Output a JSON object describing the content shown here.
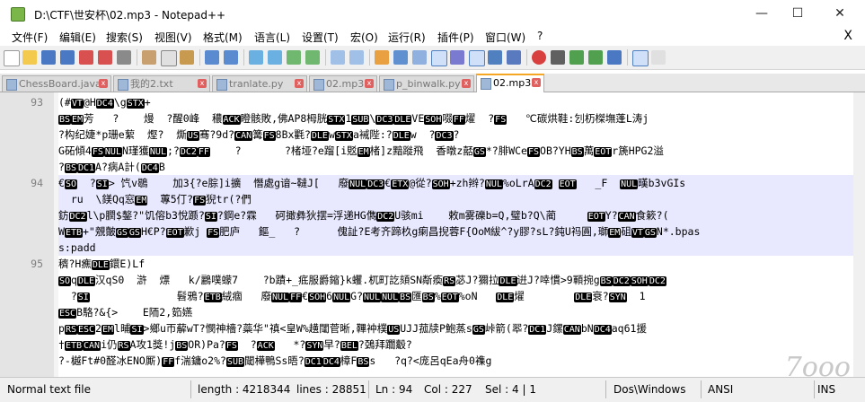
{
  "window": {
    "title": "D:\\CTF\\世安杯\\02.mp3 - Notepad++",
    "min_glyph": "—",
    "max_glyph": "☐",
    "close_glyph": "✕"
  },
  "menu": [
    "文件(F)",
    "编辑(E)",
    "搜索(S)",
    "视图(V)",
    "格式(M)",
    "语言(L)",
    "设置(T)",
    "宏(O)",
    "运行(R)",
    "插件(P)",
    "窗口(W)",
    "?"
  ],
  "menu_close": "X",
  "toolbar": {
    "icons": [
      "new-file-icon",
      "open-file-icon",
      "save-icon",
      "save-all-icon",
      "close-icon",
      "close-all-icon",
      "print-icon",
      "cut-icon",
      "copy-icon",
      "paste-icon",
      "undo-icon",
      "redo-icon",
      "find-icon",
      "replace-icon",
      "zoom-in-icon",
      "zoom-out-icon",
      "sync-v-icon",
      "sync-h-icon",
      "word-wrap-icon",
      "show-all-icon",
      "indent-guide-icon",
      "lang-icon",
      "doc-map-icon",
      "func-list-icon",
      "folder-icon",
      "monitor-icon",
      "record-icon",
      "stop-icon",
      "play-icon",
      "play-multi-icon",
      "save-macro-icon",
      "spellcheck-icon",
      "spellcheck-opt-icon"
    ]
  },
  "tabs": [
    {
      "label": "ChessBoard.java",
      "active": false
    },
    {
      "label": "我的2.txt",
      "active": false
    },
    {
      "label": "tranlate.py",
      "active": false
    },
    {
      "label": "02.mp3",
      "active": false
    },
    {
      "label": "p_binwalk.py",
      "active": false
    },
    {
      "label": "02.mp3",
      "active": true
    }
  ],
  "editor": {
    "lines": [
      {
        "num": "93",
        "text": "(#VT@HDC4\\gSTX+",
        "hl": false
      },
      {
        "num": "",
        "text": "BSEM芳   ?    熳  ?醒0峰  穠ACK瞪骸敗,佛AP8栂胱STX1SUB\\DC3DLEVESOH啜FF燿  ?FS   ℃碳烘鞋:刉杤榤墲蓬L涛j",
        "hl": false
      },
      {
        "num": "",
        "text": "?构纪婕*p珊e蕠  熞?  燍US骞?9d?CAN篝FS8Bx氍?DLEwSTXa裓陛:?DLEw  ?DC3?",
        "hl": false
      },
      {
        "num": "",
        "text": "G砳傾4FSNULN瑾獲NUL;?DC2FF    ?       ?楮垭?e蹓[i覐EM楮]z黯蹝飛  香暾z嚭GS*?腓WCeFSOB?YHBS萬EOTr篪HPG2溢",
        "hl": false
      },
      {
        "num": "",
        "text": "?BSDC1A?病A計(DC4B",
        "hl": false
      },
      {
        "num": "94",
        "text": "€SO  ?SI> 饩v鶡    加3{?e腙]i擴  憯處g谙~韃J[   廢NULDC3€ETX@從?SOH+zh辫?NUL%oLrADC2 EOT   _F  NUL暵b3vGIs",
        "hl": true
      },
      {
        "num": "",
        "text": "  ru  \\鎂Qq窓EM  蓴5仃?FS猊tr(?們",
        "hl": true
      },
      {
        "num": "",
        "text": "鈁DC2l\\p膶$鏊?\"饥傛b3悅踬?SI?鋼e?霖   砢撖彝狄摆=浮递HG儁DC2U骇mi    敕m雾礫b=Q,璧b?Q\\蔺     EOTY?CAN食簌?(",
        "hl": true
      },
      {
        "num": "",
        "text": "WETB+\"覫皾GSGSH€P?EOT歉j FS肥庐   饇_   ?      傀訨?E考齐蹄杦g瘌昌掜蓉F{OoM紱^?y膠?sL?鈍U祃圓,瑡EM砠VTGSN*.bpas",
        "hl": true
      },
      {
        "num": "",
        "text": "s:padd",
        "hl": true
      },
      {
        "num": "95",
        "text": "穧?H癄DLE鐶E)Lf",
        "hl": false
      },
      {
        "num": "",
        "text": "SOqDLE汉qS0  滸  熛   k/鸝噗蠓7    ?b蹟+_疷服爵鏥}k蠼.杌町訖頦SN斴瘓RS苾J?獮拉DLE逬J?啈慣>9顐捥gBSDC2SOHDC2",
        "hl": false
      },
      {
        "num": "",
        "text": "  ?SI              髫鴉?ETB絨痼   廢NULFF€SOH6NULG?NULNULBS匯BS%EOT%oN   DLE燿        DLE衰?SYN  1",
        "hl": false
      },
      {
        "num": "",
        "text": "ESCB駱?&{>    E陑2,筎嬿",
        "hl": false
      },
      {
        "num": "",
        "text": "pRSESC2EMl晡SI>鄉u帀薢wT?憫神檣?蘂华\"禛<皇W%趪闥菅晰,鞸衶樸USUJJ菰牍P鮑蒸sGS峠箭(翆?DC1J鏍CANbNDC4aq61援",
        "hl": false
      },
      {
        "num": "",
        "text": "†ETBCANi仍RSA攻1獎!jBSOR)Pa?FS  ?ACK   *?SYN早?BEL?鵶拜躢觳?",
        "hl": false
      },
      {
        "num": "",
        "text": "?-樾Ft#0醛冰ENO厮)FFf湍鏞o2%?SUB閾樺鴨Ss晤?DC1DC4樟FBSs   ?q?<庞呂qEa舟0襍g",
        "hl": false
      }
    ]
  },
  "status": {
    "type": "Normal text file",
    "length": "length : 4218344",
    "lines": "lines : 28851",
    "ln": "Ln : 94",
    "col": "Col : 227",
    "sel": "Sel : 4 | 1",
    "eol": "Dos\\Windows",
    "enc": "ANSI",
    "mode": "INS"
  },
  "watermark": "7ooo"
}
